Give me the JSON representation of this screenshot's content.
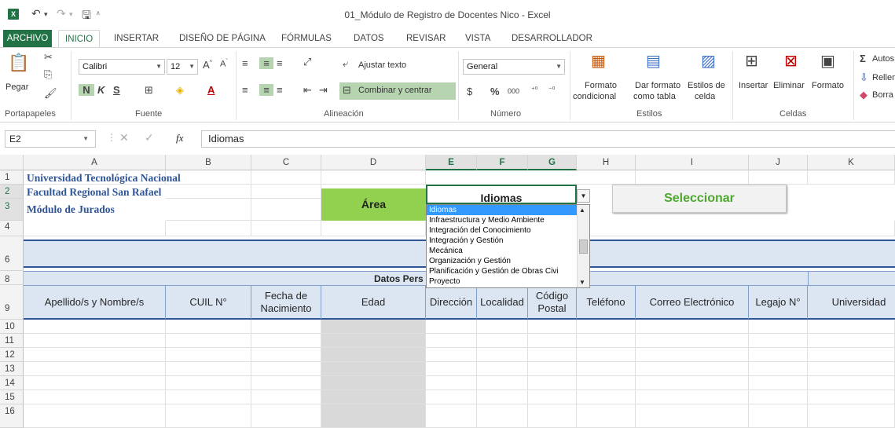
{
  "window": {
    "title": "01_Módulo de Registro de Docentes Nico - Excel",
    "app_icon": "excel-icon"
  },
  "ribbon_tabs": [
    "ARCHIVO",
    "INICIO",
    "INSERTAR",
    "DISEÑO DE PÁGINA",
    "FÓRMULAS",
    "DATOS",
    "REVISAR",
    "VISTA",
    "DESARROLLADOR"
  ],
  "ribbon": {
    "paste": "Pegar",
    "font_name": "Calibri",
    "font_size": "12",
    "bold": "N",
    "italic": "K",
    "underline": "S",
    "wrap_text": "Ajustar texto",
    "merge_center": "Combinar y centrar",
    "number_format": "General",
    "percent": "%",
    "thousands": "000",
    "currency": "$",
    "cond_format_1": "Formato",
    "cond_format_2": "condicional",
    "format_table_1": "Dar formato",
    "format_table_2": "como tabla",
    "cell_styles_1": "Estilos de",
    "cell_styles_2": "celda",
    "insert": "Insertar",
    "delete": "Eliminar",
    "format": "Formato",
    "autosum": "Autos",
    "fill": "Rellen",
    "clear": "Borra",
    "groups": {
      "clipboard": "Portapapeles",
      "font": "Fuente",
      "alignment": "Alineación",
      "number": "Número",
      "styles": "Estilos",
      "cells": "Celdas"
    }
  },
  "formula_bar": {
    "name_box": "E2",
    "content": "Idiomas",
    "fx": "fx"
  },
  "columns": [
    "A",
    "B",
    "C",
    "D",
    "E",
    "F",
    "G",
    "H",
    "I",
    "J",
    "K"
  ],
  "rows": [
    "1",
    "2",
    "3",
    "4",
    "6",
    "8",
    "9",
    "10",
    "11",
    "12",
    "13",
    "14",
    "15",
    "16"
  ],
  "sheet": {
    "a1": "Universidad Tecnológica Nacional",
    "a2": "Facultad Regional San Rafael",
    "a3": "Módulo de Jurados",
    "area_label": "Área",
    "area_value": "Idiomas",
    "select_button": "Seleccionar",
    "datos_pers": "Datos Pers",
    "headers": [
      "Apellido/s y Nombre/s",
      "CUIL N°",
      "Fecha de Nacimiento",
      "Edad",
      "Dirección",
      "Localidad",
      "Código Postal",
      "Teléfono",
      "Correo Electrónico",
      "Legajo N°",
      "Universidad"
    ]
  },
  "dropdown": {
    "items": [
      "Idiomas",
      "Infraestructura y Medio Ambiente",
      "Integración del Conocimiento",
      "Integración y Gestión",
      "Mecánica",
      "Organización y Gestión",
      "Planificación y Gestión de Obras Civi",
      "Proyecto"
    ],
    "selected_index": 0
  },
  "colors": {
    "excel_green": "#217346",
    "area_green": "#92d050",
    "select_text": "#4ea72e",
    "heading_blue": "#2f5597",
    "band_fill": "#dce6f2",
    "gray_column": "#d9d9d9"
  }
}
